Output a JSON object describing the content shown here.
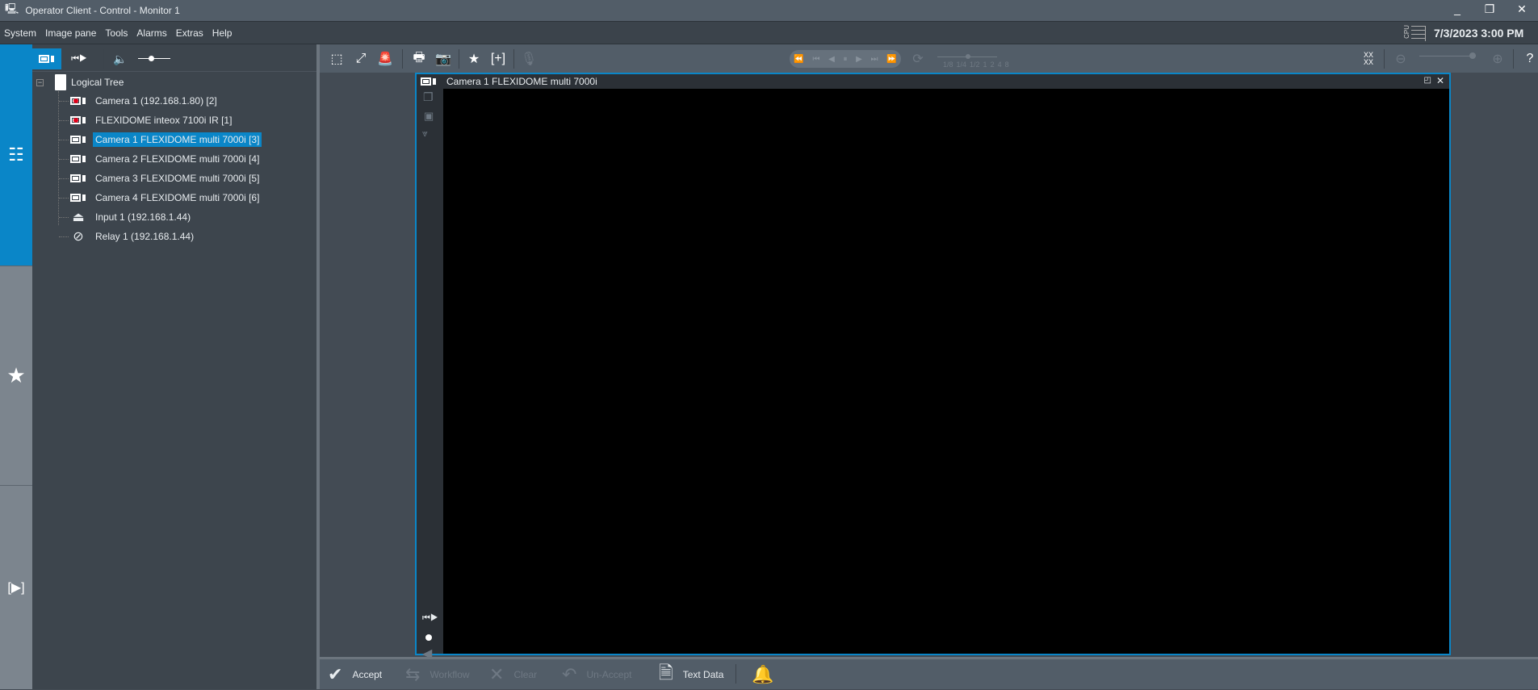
{
  "window": {
    "title": "Operator Client - Control - Monitor 1",
    "minimize": "_",
    "restore": "❐",
    "close": "✕"
  },
  "menu": [
    "System",
    "Image pane",
    "Tools",
    "Alarms",
    "Extras",
    "Help"
  ],
  "status": {
    "cpu_label": "CPU",
    "datetime": "7/3/2023 3:00 PM"
  },
  "tree": {
    "root": "Logical Tree",
    "items": [
      {
        "label": "Camera 1 (192.168.1.80) [2]",
        "icon": "dome-camera-recording-icon"
      },
      {
        "label": "FLEXIDOME inteox 7100i IR [1]",
        "icon": "camera-recording-icon"
      },
      {
        "label": "Camera 1 FLEXIDOME multi 7000i [3]",
        "icon": "camera-icon",
        "selected": true
      },
      {
        "label": "Camera 2 FLEXIDOME multi 7000i [4]",
        "icon": "camera-icon"
      },
      {
        "label": "Camera 3 FLEXIDOME multi 7000i [5]",
        "icon": "camera-icon"
      },
      {
        "label": "Camera 4 FLEXIDOME multi 7000i [6]",
        "icon": "camera-icon"
      },
      {
        "label": "Input 1 (192.168.1.44)",
        "icon": "input-icon"
      },
      {
        "label": "Relay 1 (192.168.1.44)",
        "icon": "relay-icon"
      }
    ]
  },
  "playback": {
    "speeds": [
      "1/8",
      "1/4",
      "1/2",
      "1",
      "2",
      "4",
      "8"
    ]
  },
  "pane": {
    "title": "Camera 1 FLEXIDOME multi 7000i"
  },
  "help": "?",
  "bottom": {
    "accept": "Accept",
    "workflow": "Workflow",
    "clear": "Clear",
    "unaccept": "Un-Accept",
    "textdata": "Text Data"
  },
  "colors": {
    "accent": "#0a86c8",
    "recording": "#e1001a"
  }
}
